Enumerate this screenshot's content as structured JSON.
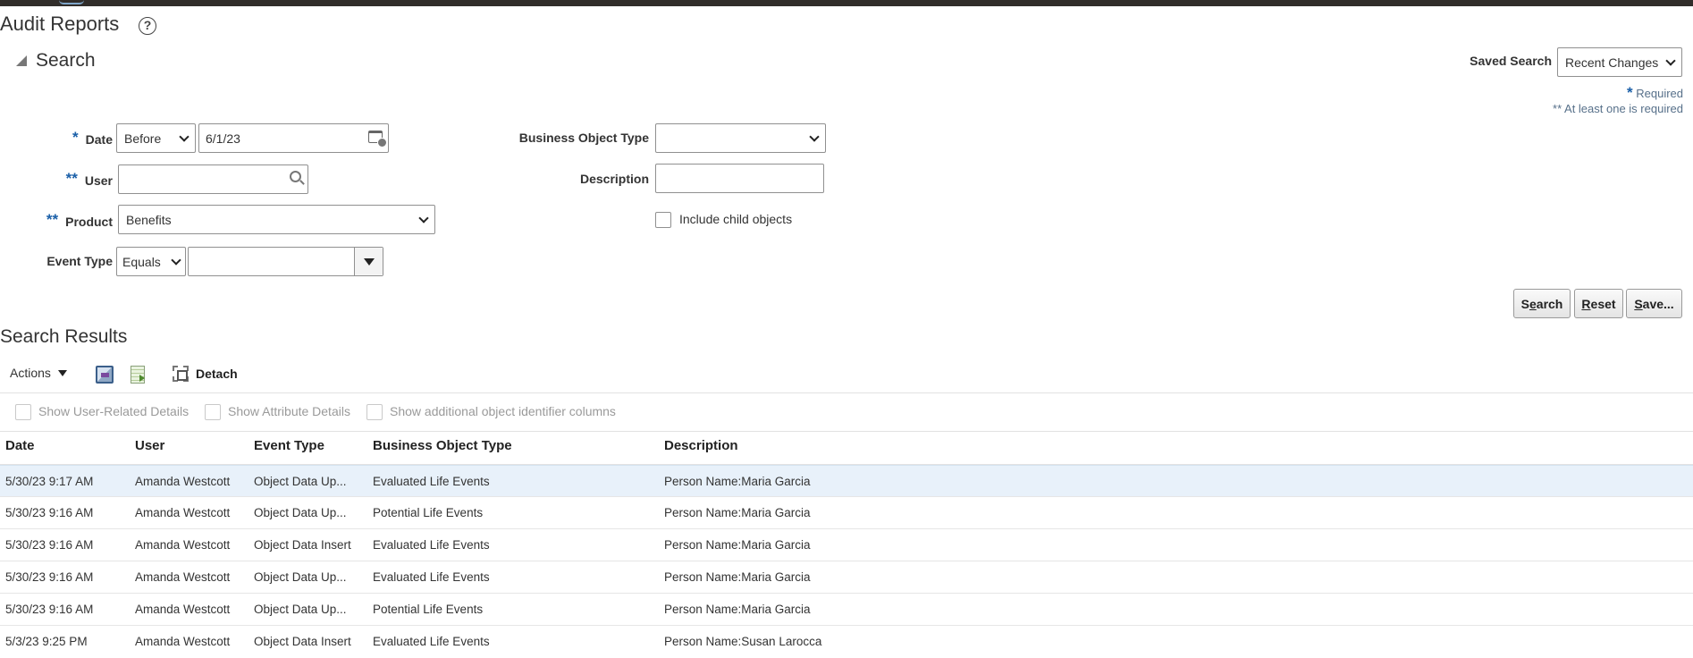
{
  "page": {
    "title": "Audit Reports"
  },
  "search": {
    "title": "Search",
    "saved_search_label": "Saved Search",
    "saved_search_value": "Recent Changes",
    "required_star": "*",
    "required_note": "Required",
    "at_least_one_note": "** At least one is required",
    "date": {
      "label": "Date",
      "marker": "*",
      "operator": "Before",
      "value": "6/1/23"
    },
    "user": {
      "label": "User",
      "marker": "**",
      "value": ""
    },
    "product": {
      "label": "Product",
      "marker": "**",
      "value": "Benefits"
    },
    "event_type": {
      "label": "Event Type",
      "operator": "Equals",
      "value": ""
    },
    "business_object_type": {
      "label": "Business Object Type",
      "value": ""
    },
    "description": {
      "label": "Description",
      "value": ""
    },
    "include_child_objects": {
      "label": "Include child objects",
      "checked": false
    },
    "buttons": {
      "search": {
        "accesskey": "S",
        "rest_a": "e",
        "key": "a",
        "rest_b": "rch"
      },
      "reset": {
        "key": "R",
        "rest": "eset"
      },
      "save": {
        "key": "S",
        "rest": "ave..."
      }
    }
  },
  "results": {
    "title": "Search Results",
    "toolbar": {
      "actions_label": "Actions",
      "detach_label": "Detach"
    },
    "options": [
      {
        "label": "Show User-Related Details",
        "checked": false
      },
      {
        "label": "Show Attribute Details",
        "checked": false
      },
      {
        "label": "Show additional object identifier columns",
        "checked": false
      }
    ],
    "columns": [
      "Date",
      "User",
      "Event Type",
      "Business Object Type",
      "Description"
    ],
    "rows": [
      {
        "date": "5/30/23 9:17 AM",
        "user": "Amanda Westcott",
        "event_type": "Object Data Up...",
        "bo_type": "Evaluated Life Events",
        "description": "Person Name:Maria Garcia"
      },
      {
        "date": "5/30/23 9:16 AM",
        "user": "Amanda Westcott",
        "event_type": "Object Data Up...",
        "bo_type": "Potential Life Events",
        "description": "Person Name:Maria Garcia"
      },
      {
        "date": "5/30/23 9:16 AM",
        "user": "Amanda Westcott",
        "event_type": "Object Data Insert",
        "bo_type": "Evaluated Life Events",
        "description": "Person Name:Maria Garcia"
      },
      {
        "date": "5/30/23 9:16 AM",
        "user": "Amanda Westcott",
        "event_type": "Object Data Up...",
        "bo_type": "Evaluated Life Events",
        "description": "Person Name:Maria Garcia"
      },
      {
        "date": "5/30/23 9:16 AM",
        "user": "Amanda Westcott",
        "event_type": "Object Data Up...",
        "bo_type": "Potential Life Events",
        "description": "Person Name:Maria Garcia"
      },
      {
        "date": "5/3/23 9:25 PM",
        "user": "Amanda Westcott",
        "event_type": "Object Data Insert",
        "bo_type": "Evaluated Life Events",
        "description": "Person Name:Susan Larocca"
      }
    ]
  },
  "colors": {
    "top_bar": "#312d2a",
    "required_marker": "#1a5fa8",
    "selected_row": "#e8f1fa"
  },
  "icons": [
    "help-icon",
    "collapse-triangle-icon",
    "chevron-down-icon",
    "calendar-icon",
    "search-icon",
    "dropdown-arrow-icon",
    "export-icon",
    "spreadsheet-icon",
    "detach-icon"
  ]
}
